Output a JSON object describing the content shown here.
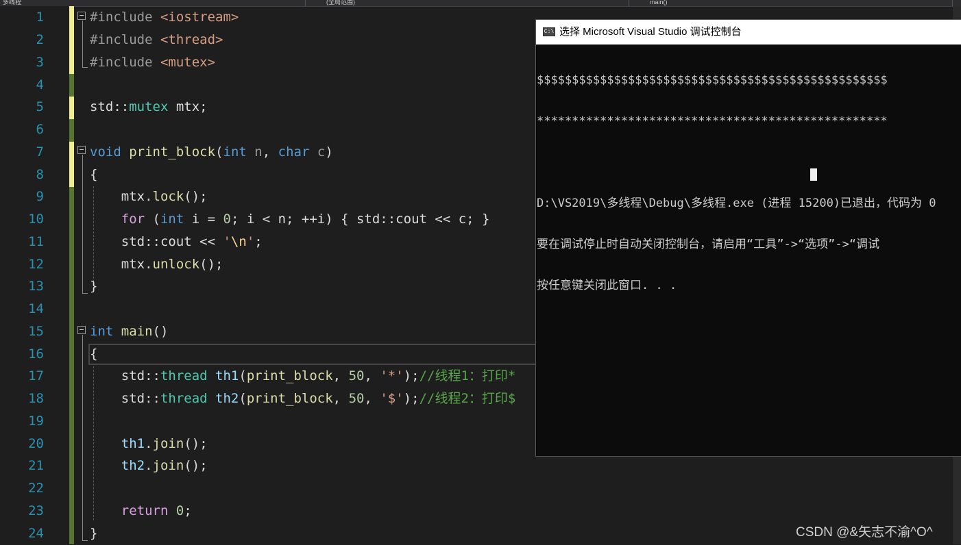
{
  "toolbar": {
    "project_dropdown": "多线程",
    "scope_dropdown": "(全局范围)",
    "member_dropdown": "main()"
  },
  "editor": {
    "line_numbers": [
      "1",
      "2",
      "3",
      "4",
      "5",
      "6",
      "7",
      "8",
      "9",
      "10",
      "11",
      "12",
      "13",
      "14",
      "15",
      "16",
      "17",
      "18",
      "19",
      "20",
      "21",
      "22",
      "23",
      "24"
    ],
    "lines": [
      "#include <iostream>",
      "#include <thread>",
      "#include <mutex>",
      "",
      "std::mutex mtx;",
      "",
      "void print_block(int n, char c)",
      "{",
      "    mtx.lock();",
      "    for (int i = 0; i < n; ++i) { std::cout << c; }",
      "    std::cout << '\\n';",
      "    mtx.unlock();",
      "}",
      "",
      "int main()",
      "{",
      "    std::thread th1(print_block, 50, '*');//线程1：打印*",
      "    std::thread th2(print_block, 50, '$');//线程2：打印$",
      "",
      "    th1.join();",
      "    th2.join();",
      "",
      "    return 0;",
      "}"
    ],
    "colors": {
      "background": "#1e1e1e",
      "line_number": "#2b91af",
      "keyword": "#569cd6",
      "type": "#4ec9b0",
      "function": "#dcdcaa",
      "string": "#d69d85",
      "comment": "#57a64a",
      "control_keyword": "#d8a0df",
      "saved_change": "#577430",
      "unsaved_change": "#efef91"
    }
  },
  "console": {
    "icon_label": "C:\\",
    "title": "选择 Microsoft Visual Studio 调试控制台",
    "output_lines": [
      "$$$$$$$$$$$$$$$$$$$$$$$$$$$$$$$$$$$$$$$$$$$$$$$$$$",
      "**************************************************",
      "",
      "D:\\VS2019\\多线程\\Debug\\多线程.exe (进程 15200)已退出，代码为 0",
      "要在调试停止时自动关闭控制台，请启用“工具”->“选项”->“调试",
      "按任意键关闭此窗口. . ."
    ]
  },
  "watermark": "CSDN @&矢志不渝^O^"
}
